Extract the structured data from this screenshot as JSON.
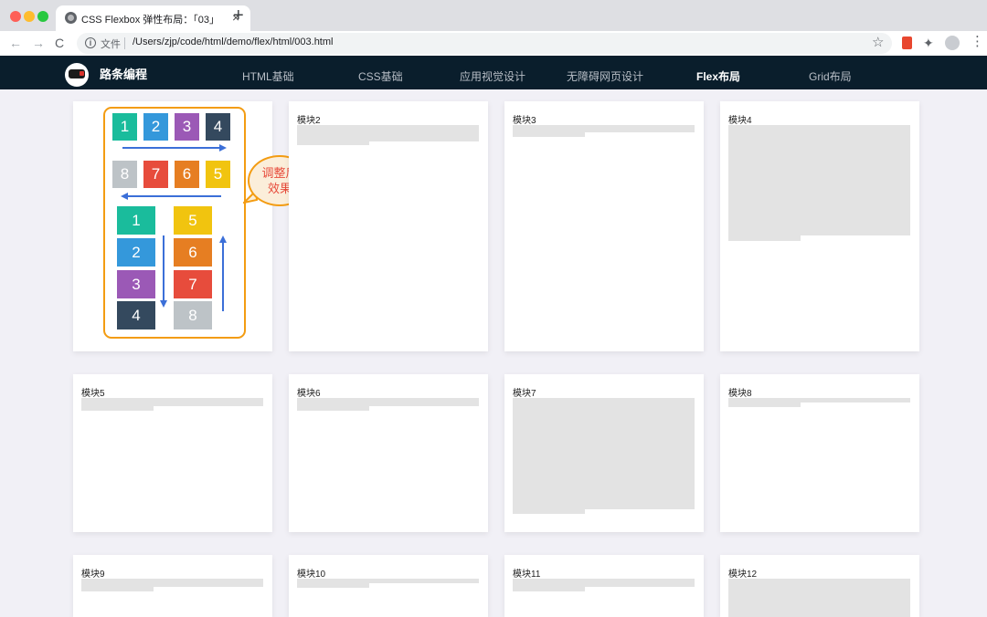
{
  "browser": {
    "tab_title": "CSS Flexbox 弹性布局：「03」",
    "tab_close": "×",
    "new_tab": "+",
    "back": "←",
    "forward": "→",
    "reload": "C",
    "info_icon": "i",
    "scheme_label": "文件",
    "url": "/Users/zjp/code/html/demo/flex/html/003.html",
    "bookmark_icon": "☆",
    "extension_icon": "puzzle-icon",
    "menu_icon": "⋮"
  },
  "site": {
    "brand": "路条编程",
    "nav": [
      {
        "label": "HTML基础",
        "active": false
      },
      {
        "label": "CSS基础",
        "active": false
      },
      {
        "label": "应用视觉设计",
        "active": false
      },
      {
        "label": "无障碍网页设计",
        "active": false
      },
      {
        "label": "Flex布局",
        "active": true
      },
      {
        "label": "Grid布局",
        "active": false
      }
    ]
  },
  "illustration": {
    "row1": [
      "1",
      "2",
      "3",
      "4"
    ],
    "row2": [
      "8",
      "7",
      "6",
      "5"
    ],
    "col1": [
      "1",
      "2",
      "3",
      "4"
    ],
    "col2": [
      "5",
      "6",
      "7",
      "8"
    ],
    "bubble_line1": "调整后",
    "bubble_line2": "效果",
    "colors": {
      "1": "#1abc9c",
      "2": "#3498db",
      "3": "#9b59b6",
      "4": "#34495e",
      "5": "#f1c40f",
      "6": "#e67e22",
      "7": "#e74c3c",
      "8": "#bdc3c7",
      "frame": "#f39c12",
      "arrow": "#3b6fd8"
    }
  },
  "modules": [
    {
      "title": "模块2"
    },
    {
      "title": "模块3"
    },
    {
      "title": "模块4"
    },
    {
      "title": "模块5"
    },
    {
      "title": "模块6"
    },
    {
      "title": "模块7"
    },
    {
      "title": "模块8"
    },
    {
      "title": "模块9"
    },
    {
      "title": "模块10"
    },
    {
      "title": "模块11"
    },
    {
      "title": "模块12"
    }
  ]
}
